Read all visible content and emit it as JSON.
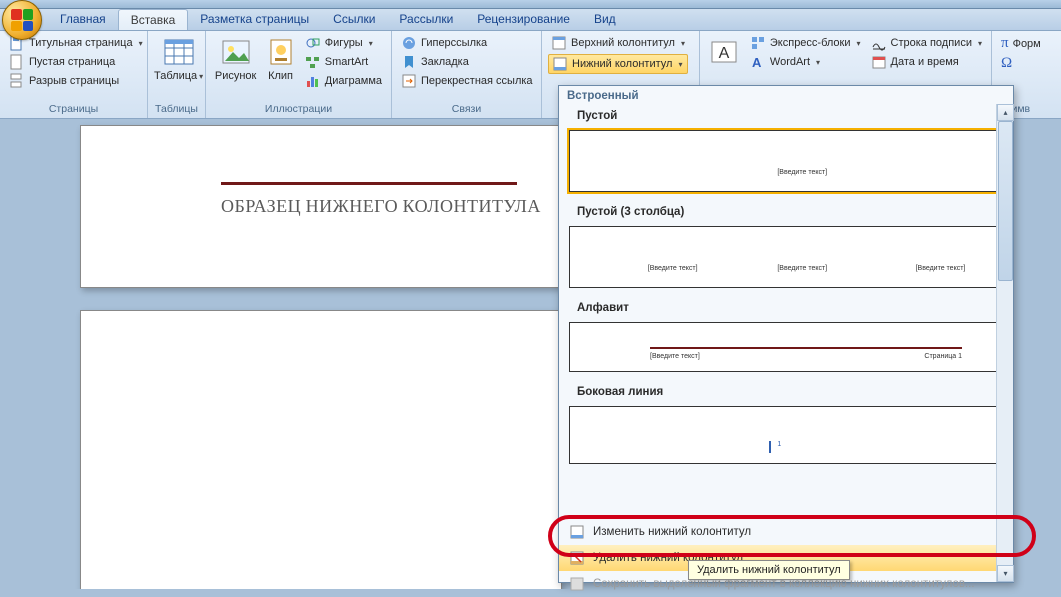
{
  "tabs": {
    "home": "Главная",
    "insert": "Вставка",
    "layout": "Разметка страницы",
    "refs": "Ссылки",
    "mail": "Рассылки",
    "review": "Рецензирование",
    "view": "Вид"
  },
  "groups": {
    "pages": {
      "title": "Страницы",
      "cover": "Титульная страница",
      "blank": "Пустая страница",
      "break": "Разрыв страницы"
    },
    "tables": {
      "title": "Таблицы",
      "table": "Таблица"
    },
    "illus": {
      "title": "Иллюстрации",
      "picture": "Рисунок",
      "clip": "Клип",
      "shapes": "Фигуры",
      "smartart": "SmartArt",
      "chart": "Диаграмма"
    },
    "links": {
      "title": "Связи",
      "hyper": "Гиперссылка",
      "bookmark": "Закладка",
      "crossref": "Перекрестная ссылка"
    },
    "hf": {
      "header": "Верхний колонтитул",
      "footer": "Нижний колонтитул"
    },
    "text": {
      "textbox": "A",
      "quick": "Экспресс-блоки",
      "wordart": "WordArt",
      "sigline": "Строка подписи",
      "datetime": "Дата и время"
    },
    "sym": {
      "title": "Симв",
      "eq": "Форм"
    }
  },
  "document": {
    "sample_title": "ОБРАЗЕЦ НИЖНЕГО КОЛОНТИТУЛА"
  },
  "gallery": {
    "header": "Встроенный",
    "empty": "Пустой",
    "empty3": "Пустой (3 столбца)",
    "alpha": "Алфавит",
    "sideline": "Боковая линия",
    "placeholder": "[Введите текст]",
    "page_n": "Страница 1",
    "edit": "Изменить нижний колонтитул",
    "remove": "Удалить нижний колонтитул",
    "save_sel": "Сохранить выделенный фрагмент в коллекцию нижних колонтитулов..."
  },
  "tooltip": "Удалить нижний колонтитул"
}
